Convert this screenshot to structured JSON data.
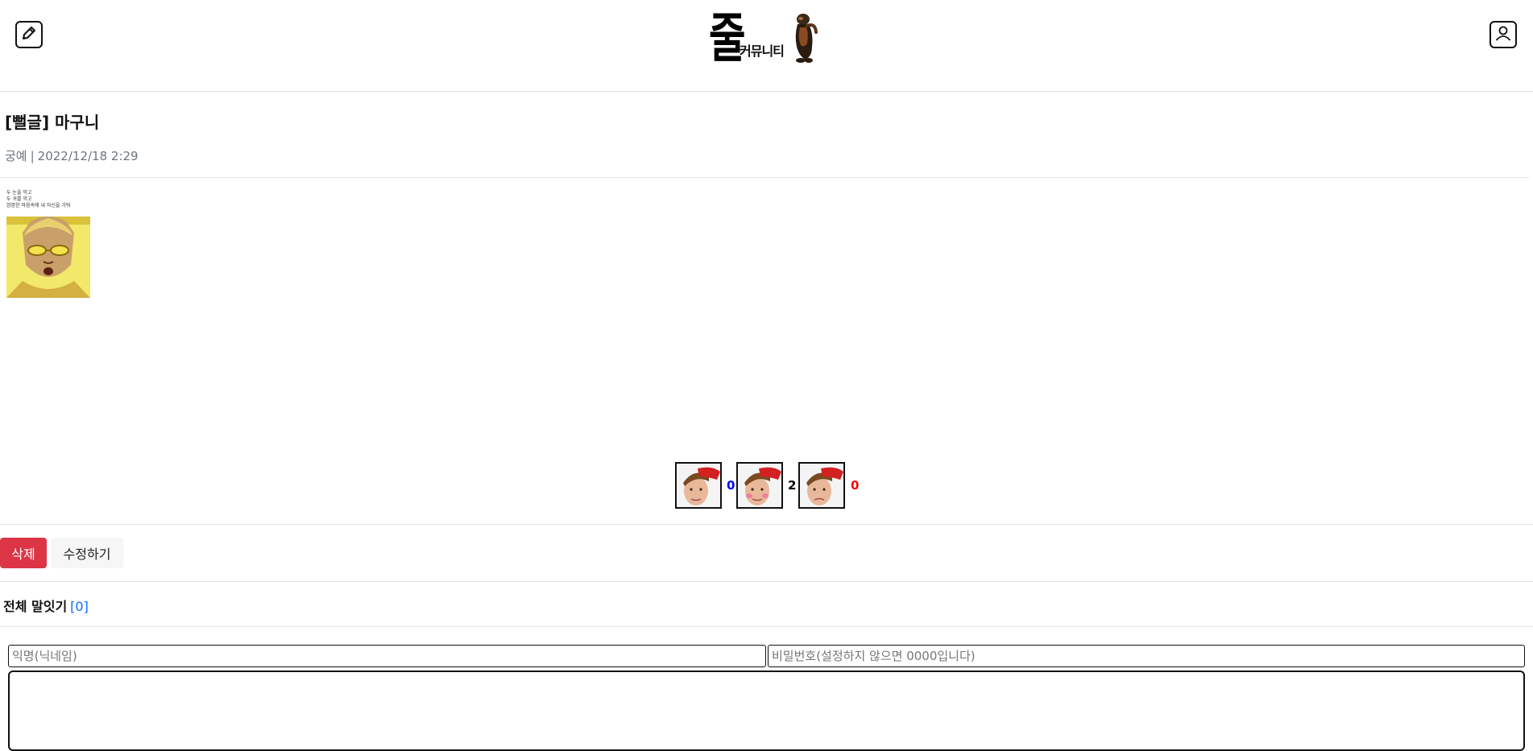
{
  "header": {
    "logo_text": "줄",
    "logo_subtitle": "커뮤니티",
    "write_icon": "pencil-square-icon",
    "user_icon": "user-square-icon"
  },
  "post": {
    "title": "[뻘글] 마구니",
    "author": "궁예",
    "separator": "|",
    "date": "2022/12/18 2:29",
    "image_caption_lines": [
      "두 눈을 막고",
      "두 귀를 막고",
      "깜깜한 마음속에 내 자신을 가둬"
    ]
  },
  "reactions": [
    {
      "label": "즐겁다",
      "count": "0",
      "color": "#0000ff"
    },
    {
      "label": "ㅗㅜㅑ",
      "count": "2",
      "color": "#000000"
    },
    {
      "label": "화난다",
      "count": "0",
      "color": "#ff0000"
    }
  ],
  "actions": {
    "delete_label": "삭제",
    "edit_label": "수정하기"
  },
  "comments": {
    "heading": "전체 말잇기",
    "count": "[0]",
    "nickname_placeholder": "익명(닉네임)",
    "password_placeholder": "비밀번호(설정하지 않으면 0000입니다)",
    "body_value": ""
  },
  "colors": {
    "danger": "#dc3545",
    "link": "#0d6efd",
    "muted": "#6c757d"
  }
}
